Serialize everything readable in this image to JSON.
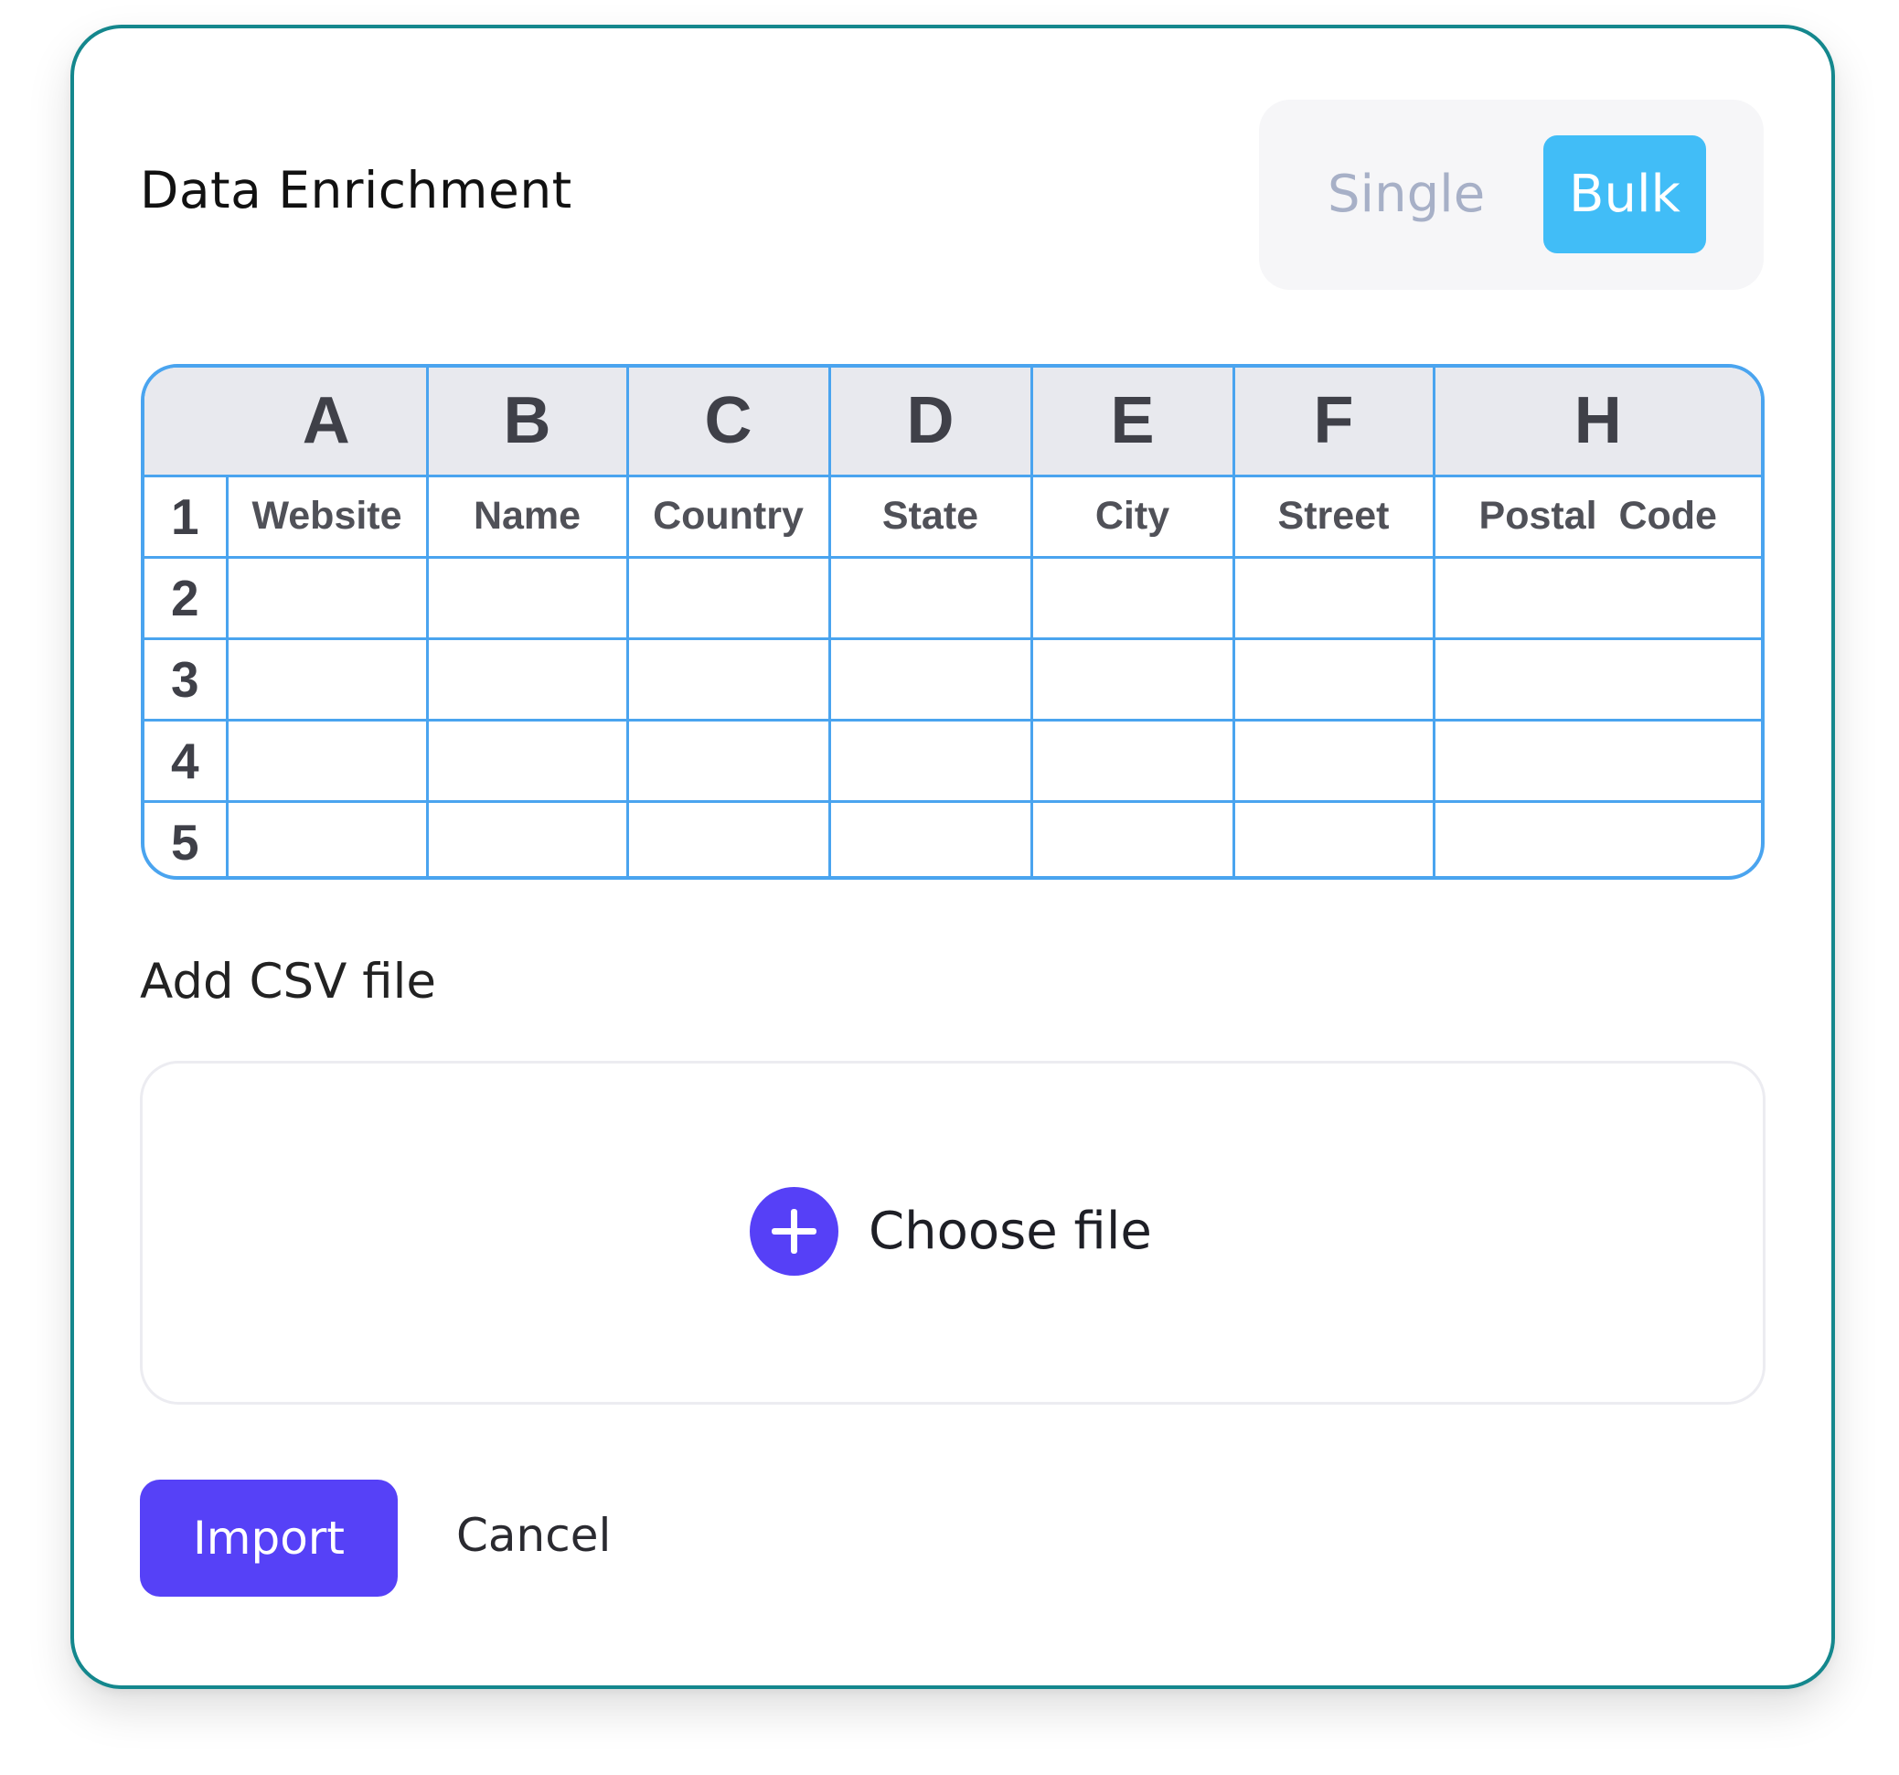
{
  "dialog": {
    "title": "Data Enrichment",
    "mode_toggle": {
      "options": [
        "Single",
        "Bulk"
      ],
      "selected": "Bulk"
    }
  },
  "spreadsheet": {
    "column_letters": [
      "A",
      "B",
      "C",
      "D",
      "E",
      "F",
      "H"
    ],
    "row_numbers": [
      "1",
      "2",
      "3",
      "4",
      "5"
    ],
    "header_row": [
      "Website",
      "Name",
      "Country",
      "State",
      "City",
      "Street",
      "Postal  Code"
    ],
    "data_rows": [
      [
        "",
        "",
        "",
        "",
        "",
        "",
        ""
      ],
      [
        "",
        "",
        "",
        "",
        "",
        "",
        ""
      ],
      [
        "",
        "",
        "",
        "",
        "",
        "",
        ""
      ],
      [
        "",
        "",
        "",
        "",
        "",
        "",
        ""
      ]
    ]
  },
  "upload": {
    "section_label": "Add CSV file",
    "choose_file_label": "Choose file"
  },
  "actions": {
    "import_label": "Import",
    "cancel_label": "Cancel"
  },
  "colors": {
    "card_border": "#14878d",
    "toggle_active": "#41bdf7",
    "toggle_inactive_text": "#a7b0c7",
    "grid_line": "#4aa4ef",
    "header_fill": "#e8e9ee",
    "primary": "#5641f7"
  }
}
